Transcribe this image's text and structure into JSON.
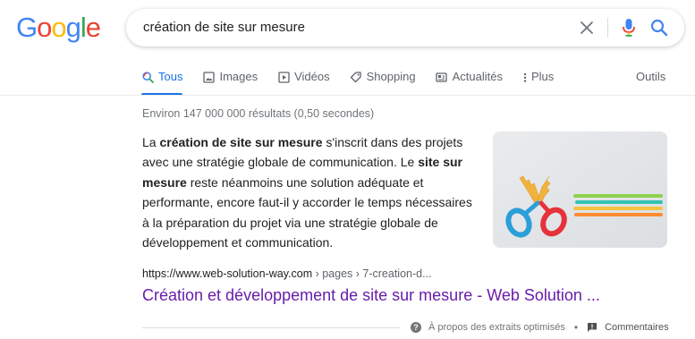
{
  "logo": {
    "letters": [
      "G",
      "o",
      "o",
      "g",
      "l",
      "e"
    ],
    "colors": [
      "#4285F4",
      "#EA4335",
      "#FBBC05",
      "#4285F4",
      "#34A853",
      "#EA4335"
    ]
  },
  "search": {
    "query": "création de site sur mesure"
  },
  "tabs": [
    {
      "label": "Tous",
      "icon": "search-icon",
      "active": true
    },
    {
      "label": "Images",
      "icon": "image-icon",
      "active": false
    },
    {
      "label": "Vidéos",
      "icon": "video-icon",
      "active": false
    },
    {
      "label": "Shopping",
      "icon": "tag-icon",
      "active": false
    },
    {
      "label": "Actualités",
      "icon": "news-icon",
      "active": false
    },
    {
      "label": "Plus",
      "icon": "more-icon",
      "active": false
    }
  ],
  "tools_label": "Outils",
  "result_stats": "Environ 147 000 000 résultats (0,50 secondes)",
  "snippet": {
    "parts": [
      {
        "text": "La ",
        "bold": false
      },
      {
        "text": "création de site sur mesure",
        "bold": true
      },
      {
        "text": " s'inscrit dans des projets avec une stratégie globale de communication. Le ",
        "bold": false
      },
      {
        "text": "site sur mesure",
        "bold": true
      },
      {
        "text": " reste néanmoins une solution adéquate et performante, encore faut-il y accorder le temps nécessaires à la préparation du projet via une stratégie globale de développement et communication.",
        "bold": false
      }
    ]
  },
  "result": {
    "url": "https://www.web-solution-way.com",
    "breadcrumbs": " › pages › 7-creation-d...",
    "title": "Création et développement de site sur mesure - Web Solution ..."
  },
  "footer": {
    "about_label": "À propos des extraits optimisés",
    "separator": "•",
    "feedback_label": "Commentaires"
  },
  "colors": {
    "accent": "#1a73e8",
    "visited_link": "#681da8",
    "secondary_text": "#70757a"
  }
}
